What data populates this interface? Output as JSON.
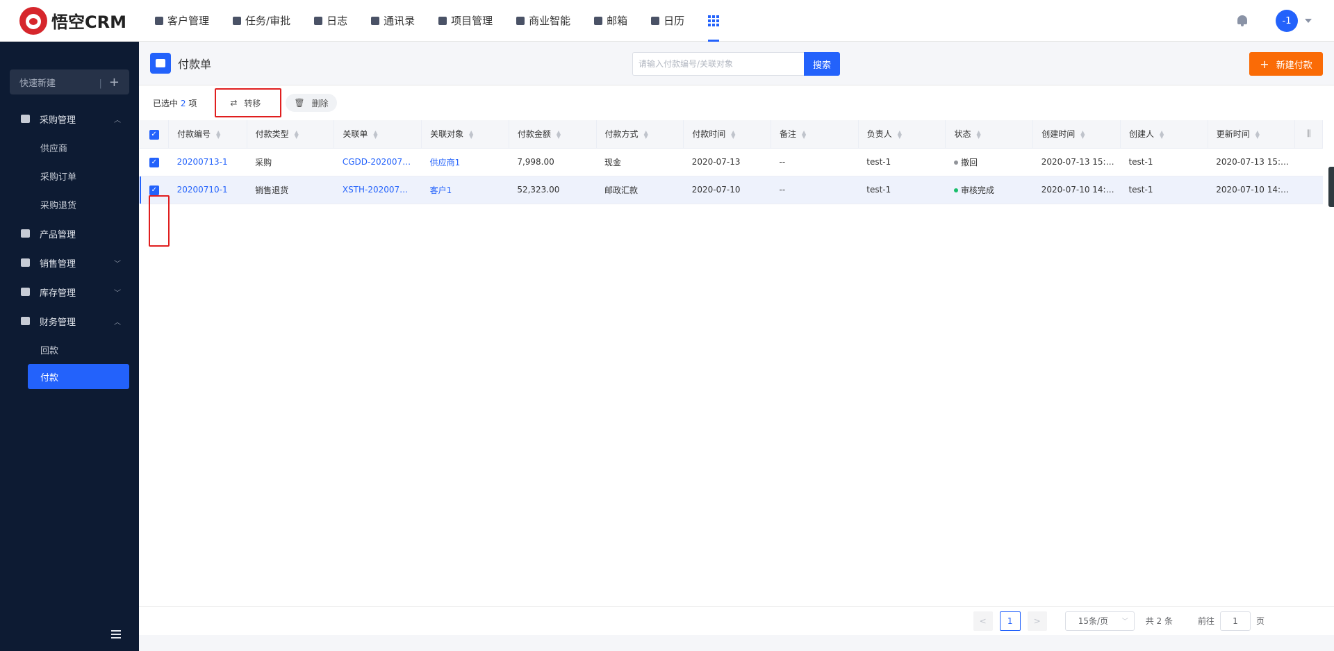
{
  "app": {
    "logo_text": "悟空CRM"
  },
  "nav": {
    "items": [
      {
        "label": "客户管理",
        "icon": "building-icon"
      },
      {
        "label": "任务/审批",
        "icon": "briefcase-icon"
      },
      {
        "label": "日志",
        "icon": "notebook-icon"
      },
      {
        "label": "通讯录",
        "icon": "phone-book-icon"
      },
      {
        "label": "项目管理",
        "icon": "project-icon"
      },
      {
        "label": "商业智能",
        "icon": "bi-icon"
      },
      {
        "label": "邮箱",
        "icon": "mail-icon"
      },
      {
        "label": "日历",
        "icon": "calendar-icon"
      }
    ],
    "apps_icon": "grid-apps-icon"
  },
  "user": {
    "avatar_text": "-1"
  },
  "sidebar": {
    "quick_new": {
      "label": "快速新建",
      "divider": "|",
      "plus": "+"
    },
    "groups": {
      "purchase": {
        "label": "采购管理",
        "expanded": true,
        "items": [
          "供应商",
          "采购订单",
          "采购退货"
        ]
      },
      "product": {
        "label": "产品管理"
      },
      "sales": {
        "label": "销售管理"
      },
      "stock": {
        "label": "库存管理"
      },
      "finance": {
        "label": "财务管理",
        "expanded": true,
        "items": [
          "回款",
          "付款"
        ],
        "active_item": "付款"
      }
    }
  },
  "page": {
    "title": "付款单",
    "search_placeholder": "请输入付款编号/关联对象",
    "search_button": "搜索",
    "new_button": "新建付款",
    "new_button_plus": "+"
  },
  "toolbar": {
    "selected_prefix": "已选中",
    "selected_count": "2",
    "selected_suffix": "项",
    "transfer": "转移",
    "delete": "删除"
  },
  "table": {
    "columns": [
      "付款编号",
      "付款类型",
      "关联单",
      "关联对象",
      "付款金额",
      "付款方式",
      "付款时间",
      "备注",
      "负责人",
      "状态",
      "创建时间",
      "创建人",
      "更新时间"
    ],
    "rows": [
      {
        "checked": true,
        "code": "20200713-1",
        "type": "采购",
        "related_order": "CGDD-202007…",
        "related_object": "供应商1",
        "amount": "7,998.00",
        "method": "现金",
        "pay_date": "2020-07-13",
        "remark": "--",
        "owner": "test-1",
        "status": "撤回",
        "status_color": "#909399",
        "created": "2020-07-13 15:…",
        "creator": "test-1",
        "updated": "2020-07-13 15:…"
      },
      {
        "checked": true,
        "code": "20200710-1",
        "type": "销售退货",
        "related_order": "XSTH-202007…",
        "related_object": "客户1",
        "amount": "52,323.00",
        "method": "邮政汇款",
        "pay_date": "2020-07-10",
        "remark": "--",
        "owner": "test-1",
        "status": "审核完成",
        "status_color": "#19be6b",
        "created": "2020-07-10 14:…",
        "creator": "test-1",
        "updated": "2020-07-10 14:…"
      }
    ]
  },
  "pagination": {
    "prev": "<",
    "current": "1",
    "next": ">",
    "page_size": "15条/页",
    "total": "共 2 条",
    "goto_prefix": "前往",
    "goto_value": "1",
    "goto_suffix": "页"
  },
  "colors": {
    "primary": "#2362fb",
    "accent": "#fa6b06",
    "sidebar_bg": "#0d1b33"
  }
}
